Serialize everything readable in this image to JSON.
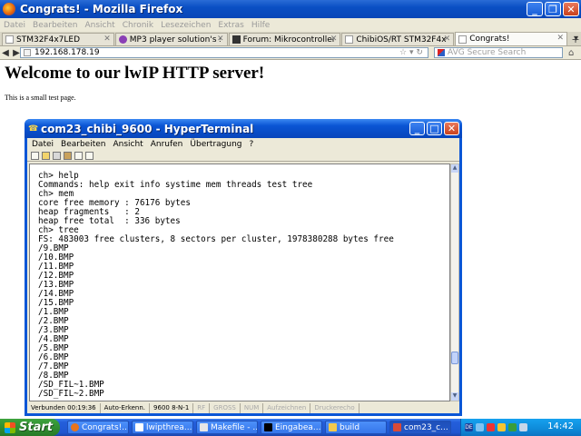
{
  "firefox": {
    "title": "Congrats! - Mozilla Firefox",
    "menu": [
      "Datei",
      "Bearbeiten",
      "Ansicht",
      "Chronik",
      "Lesezeichen",
      "Extras",
      "Hilfe"
    ],
    "tabs": [
      {
        "label": "STM32F4x7LED",
        "active": false
      },
      {
        "label": "MP3 player solution's s...",
        "active": false
      },
      {
        "label": "Forum: Mikrocontroller ...",
        "active": false
      },
      {
        "label": "ChibiOS/RT STM32F4x...",
        "active": false
      },
      {
        "label": "Congrats!",
        "active": true
      }
    ],
    "url": "192.168.178.19",
    "search_placeholder": "AVG Secure Search"
  },
  "page": {
    "heading": "Welcome to our lwIP HTTP server!",
    "paragraph": "This is a small test page."
  },
  "hyperterminal": {
    "title": "com23_chibi_9600 - HyperTerminal",
    "menu": [
      "Datei",
      "Bearbeiten",
      "Ansicht",
      "Anrufen",
      "Übertragung",
      "?"
    ],
    "terminal_lines": [
      "ch> help",
      "Commands: help exit info systime mem threads test tree",
      "ch> mem",
      "core free memory : 76176 bytes",
      "heap fragments   : 2",
      "heap free total  : 336 bytes",
      "ch> tree",
      "FS: 483003 free clusters, 8 sectors per cluster, 1978380288 bytes free",
      "/9.BMP",
      "/10.BMP",
      "/11.BMP",
      "/12.BMP",
      "/13.BMP",
      "/14.BMP",
      "/15.BMP",
      "/1.BMP",
      "/2.BMP",
      "/3.BMP",
      "/4.BMP",
      "/5.BMP",
      "/6.BMP",
      "/7.BMP",
      "/8.BMP",
      "/SD_FIL~1.BMP",
      "/SD_FIL~2.BMP"
    ],
    "status": {
      "connected": "Verbunden 00:19:36",
      "detect": "Auto-Erkenn.",
      "baud": "9600 8-N-1",
      "rf": "RF",
      "caps": "GROSS",
      "num": "NUM",
      "capture": "Aufzeichnen",
      "print_echo": "Druckerecho"
    }
  },
  "taskbar": {
    "start_label": "Start",
    "buttons": [
      {
        "label": "Congrats!...",
        "icon_color": "#e8741c"
      },
      {
        "label": "lwipthrea...",
        "icon_color": "#ffffff"
      },
      {
        "label": "Makefile - ...",
        "icon_color": "#e6e6e6"
      },
      {
        "label": "Eingabea...",
        "icon_color": "#000000"
      },
      {
        "label": "build",
        "icon_color": "#f2c94c"
      },
      {
        "label": "com23_c...",
        "icon_color": "#d94a38"
      }
    ],
    "clock": "14:42"
  }
}
